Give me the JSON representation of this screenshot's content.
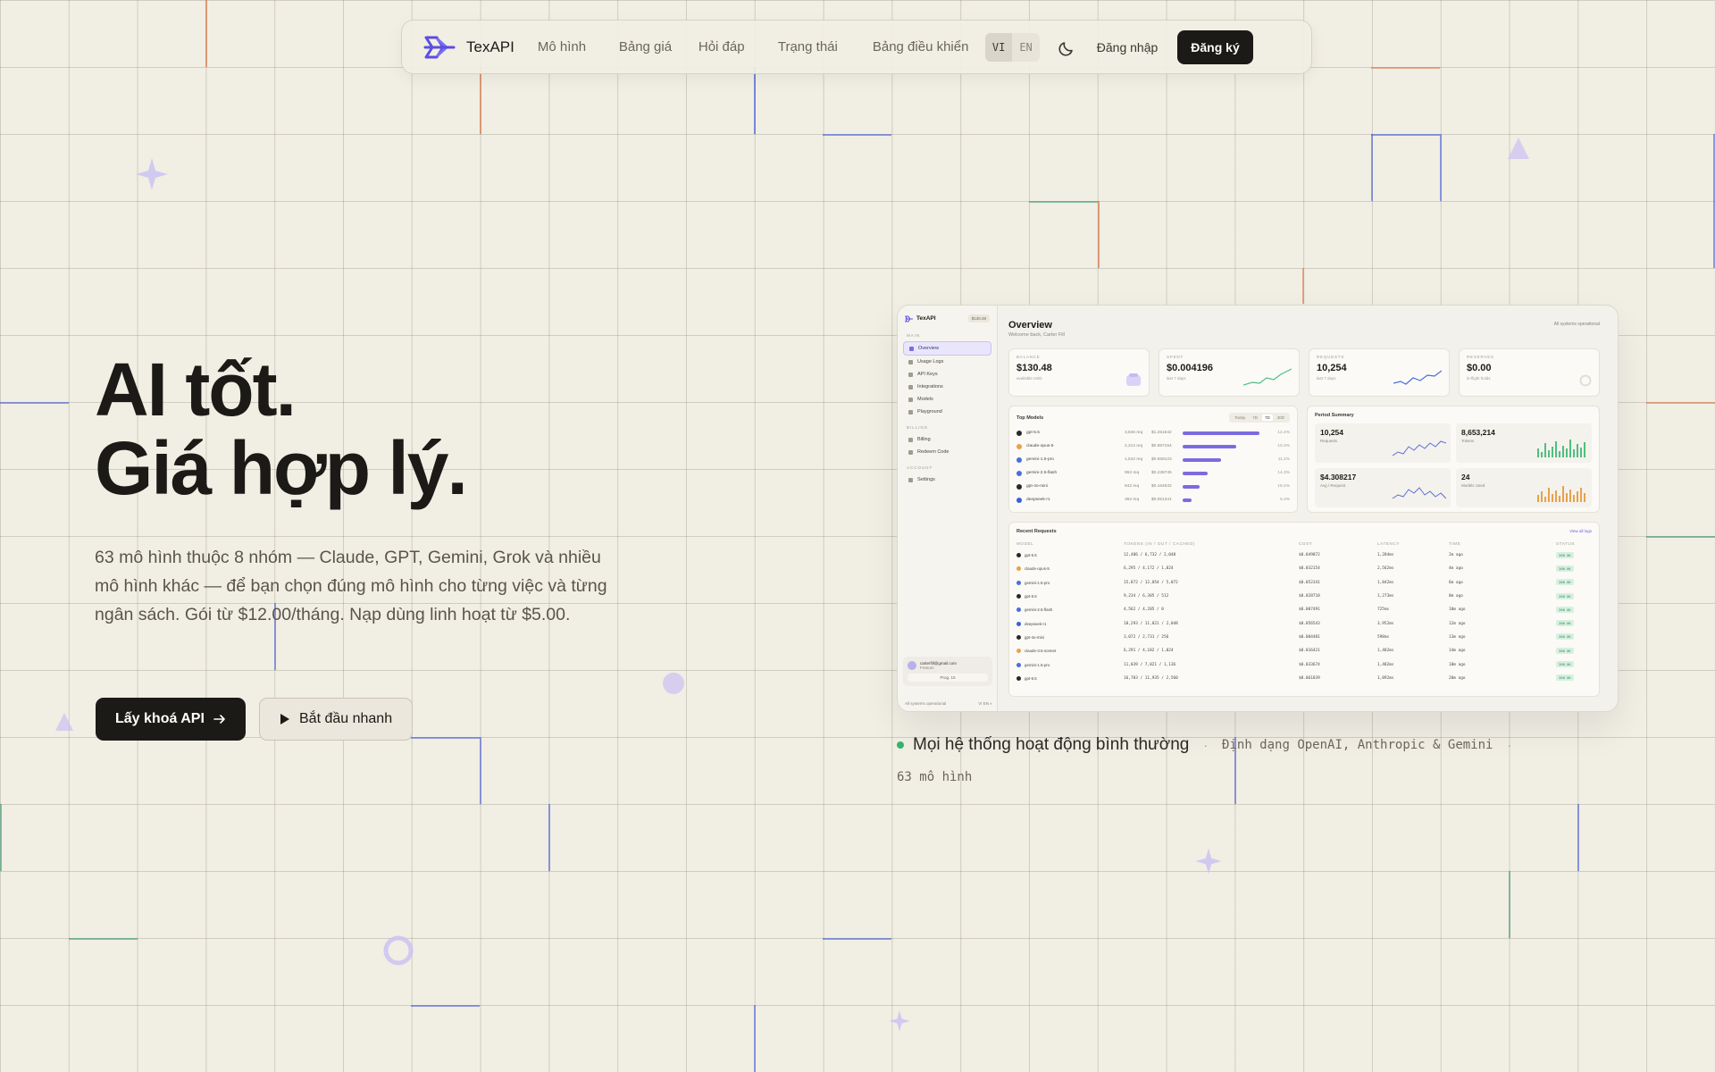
{
  "brand": {
    "name": "TexAPI",
    "accent": "#5b4ee0"
  },
  "nav": {
    "links": [
      "Mô hình",
      "Bảng giá",
      "Hỏi đáp",
      "Trạng thái",
      "Bảng điều khiển"
    ],
    "lang_vi": "VI",
    "lang_en": "EN",
    "login": "Đăng nhập",
    "signup": "Đăng ký"
  },
  "hero": {
    "title_line1": "AI tốt.",
    "title_line2": "Giá hợp lý.",
    "description": "63 mô hình thuộc 8 nhóm — Claude, GPT, Gemini, Grok và nhiều mô hình khác — để bạn chọn đúng mô hình cho từng việc và từng ngân sách. Gói từ $12.00/tháng. Nạp dùng linh hoạt từ $5.00.",
    "primary_button": "Lấy khoá API",
    "secondary_button": "Bắt đầu nhanh"
  },
  "status": {
    "text": "Mọi hệ thống hoạt động bình thường",
    "formats": "Định dạng OpenAI, Anthropic & Gemini",
    "model_count": "63 mô hình",
    "color": "#34b46b"
  },
  "dashboard": {
    "brand": "TexAPI",
    "balance_chip": "$130.48",
    "sections": {
      "main": "MAIN",
      "billing": "BILLING",
      "account": "ACCOUNT"
    },
    "menu_main": [
      "Overview",
      "Usage Logs",
      "API Keys",
      "Integrations",
      "Models",
      "Playground"
    ],
    "menu_billing": [
      "Billing",
      "Redeem Code"
    ],
    "menu_account": [
      "Settings"
    ],
    "user_email": "carterfill@gmail.com",
    "user_plan": "Freeum",
    "user_action": "Prog. 10",
    "sidebar_status": "All systems operational",
    "title": "Overview",
    "subtitle": "Welcome back, Carter Fill",
    "system_status": "All systems operational",
    "kpis": [
      {
        "label": "BALANCE",
        "value": "$130.48",
        "note": "available USD"
      },
      {
        "label": "SPENT",
        "value": "$0.004196",
        "note": "last 7 days"
      },
      {
        "label": "REQUESTS",
        "value": "10,254",
        "note": "last 7 days"
      },
      {
        "label": "RESERVES",
        "value": "$0.00",
        "note": "in-flight holds"
      }
    ],
    "top_models": {
      "title": "Top Models",
      "ranges": [
        "Today",
        "7D",
        "7D",
        "30D"
      ],
      "rows": [
        {
          "name": "gpt-5.5",
          "req": "3,846 req",
          "cost": "$1.251642",
          "pct": "12.4%",
          "share": 1.0
        },
        {
          "name": "claude-opus-5",
          "req": "2,212 req",
          "cost": "$0.987154",
          "pct": "10.3%",
          "share": 0.7
        },
        {
          "name": "gemini-1.5-pro",
          "req": "1,542 req",
          "cost": "$0.658123",
          "pct": "11.2%",
          "share": 0.5
        },
        {
          "name": "gemini-2.5-flash",
          "req": "952 req",
          "cost": "$0.238745",
          "pct": "14.3%",
          "share": 0.33
        },
        {
          "name": "gpt-4o-mini",
          "req": "642 req",
          "cost": "$0.164632",
          "pct": "18.4%",
          "share": 0.22
        },
        {
          "name": "deepseek-r1",
          "req": "362 req",
          "cost": "$0.051341",
          "pct": "5.4%",
          "share": 0.12
        }
      ]
    },
    "period_summary": {
      "title": "Period Summary",
      "cells": [
        {
          "value": "10,254",
          "label": "Requests"
        },
        {
          "value": "8,653,214",
          "label": "Tokens"
        },
        {
          "value": "$4.308217",
          "label": "Avg / Request"
        },
        {
          "value": "24",
          "label": "Models Used"
        }
      ]
    },
    "recent": {
      "title": "Recent Requests",
      "view_all": "View all logs",
      "headers": [
        "MODEL",
        "TOKENS (IN / OUT / CACHED)",
        "COST",
        "LATENCY",
        "TIME",
        "STATUS"
      ],
      "rows": [
        [
          "gpt-5.5",
          "12,486 / 6,732 / 2,048",
          "$0.049872",
          "1,284ms",
          "2m ago",
          "200 OK"
        ],
        [
          "claude-opus-5",
          "6,295 / 4,172 / 1,024",
          "$0.032154",
          "2,562ms",
          "4m ago",
          "200 OK"
        ],
        [
          "gemini-1.5-pro",
          "15,872 / 12,054 / 5,072",
          "$0.052341",
          "1,842ms",
          "6m ago",
          "200 OK"
        ],
        [
          "gpt-5.5",
          "9,234 / 6,305 / 512",
          "$0.028718",
          "1,273ms",
          "8m ago",
          "200 OK"
        ],
        [
          "gemini-2.5-flash",
          "4,562 / 4,205 / 0",
          "$0.007491",
          "725ms",
          "10m ago",
          "200 OK"
        ],
        [
          "deepseek-r1",
          "18,293 / 11,821 / 2,048",
          "$0.056543",
          "3,952ms",
          "12m ago",
          "200 OK"
        ],
        [
          "gpt-4o-mini",
          "3,072 / 2,731 / 256",
          "$0.004481",
          "598ms",
          "13m ago",
          "200 OK"
        ],
        [
          "claude-3.5-sonnet",
          "6,291 / 4,182 / 1,024",
          "$0.016421",
          "1,482ms",
          "14m ago",
          "200 OK"
        ],
        [
          "gemini-1.5-pro",
          "11,039 / 7,821 / 1,136",
          "$0.033674",
          "1,482ms",
          "18m ago",
          "200 OK"
        ],
        [
          "gpt-5.5",
          "16,703 / 11,935 / 2,560",
          "$0.061839",
          "1,892ms",
          "20m ago",
          "200 OK"
        ]
      ]
    }
  }
}
